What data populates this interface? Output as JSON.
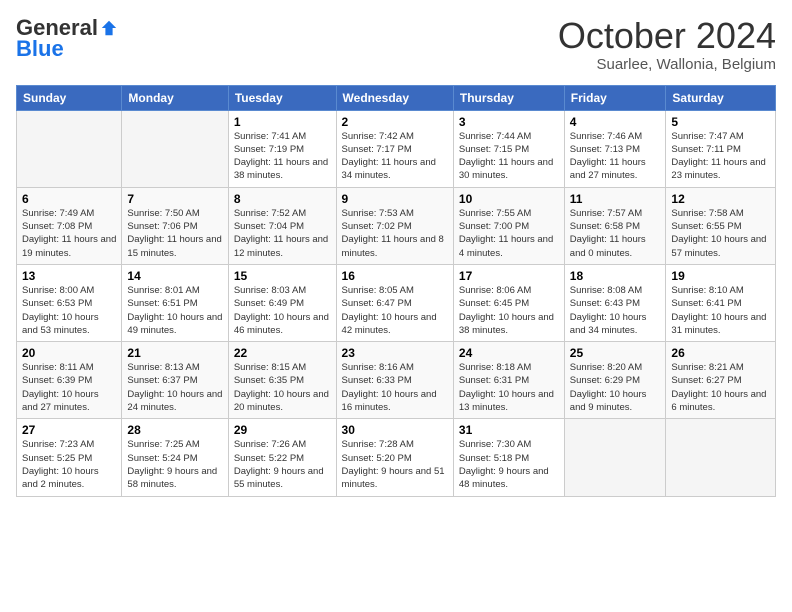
{
  "header": {
    "logo_general": "General",
    "logo_blue": "Blue",
    "month_title": "October 2024",
    "subtitle": "Suarlee, Wallonia, Belgium"
  },
  "days_of_week": [
    "Sunday",
    "Monday",
    "Tuesday",
    "Wednesday",
    "Thursday",
    "Friday",
    "Saturday"
  ],
  "weeks": [
    [
      {
        "day": "",
        "sunrise": "",
        "sunset": "",
        "daylight": "",
        "empty": true
      },
      {
        "day": "",
        "sunrise": "",
        "sunset": "",
        "daylight": "",
        "empty": true
      },
      {
        "day": "1",
        "sunrise": "Sunrise: 7:41 AM",
        "sunset": "Sunset: 7:19 PM",
        "daylight": "Daylight: 11 hours and 38 minutes.",
        "empty": false
      },
      {
        "day": "2",
        "sunrise": "Sunrise: 7:42 AM",
        "sunset": "Sunset: 7:17 PM",
        "daylight": "Daylight: 11 hours and 34 minutes.",
        "empty": false
      },
      {
        "day": "3",
        "sunrise": "Sunrise: 7:44 AM",
        "sunset": "Sunset: 7:15 PM",
        "daylight": "Daylight: 11 hours and 30 minutes.",
        "empty": false
      },
      {
        "day": "4",
        "sunrise": "Sunrise: 7:46 AM",
        "sunset": "Sunset: 7:13 PM",
        "daylight": "Daylight: 11 hours and 27 minutes.",
        "empty": false
      },
      {
        "day": "5",
        "sunrise": "Sunrise: 7:47 AM",
        "sunset": "Sunset: 7:11 PM",
        "daylight": "Daylight: 11 hours and 23 minutes.",
        "empty": false
      }
    ],
    [
      {
        "day": "6",
        "sunrise": "Sunrise: 7:49 AM",
        "sunset": "Sunset: 7:08 PM",
        "daylight": "Daylight: 11 hours and 19 minutes.",
        "empty": false
      },
      {
        "day": "7",
        "sunrise": "Sunrise: 7:50 AM",
        "sunset": "Sunset: 7:06 PM",
        "daylight": "Daylight: 11 hours and 15 minutes.",
        "empty": false
      },
      {
        "day": "8",
        "sunrise": "Sunrise: 7:52 AM",
        "sunset": "Sunset: 7:04 PM",
        "daylight": "Daylight: 11 hours and 12 minutes.",
        "empty": false
      },
      {
        "day": "9",
        "sunrise": "Sunrise: 7:53 AM",
        "sunset": "Sunset: 7:02 PM",
        "daylight": "Daylight: 11 hours and 8 minutes.",
        "empty": false
      },
      {
        "day": "10",
        "sunrise": "Sunrise: 7:55 AM",
        "sunset": "Sunset: 7:00 PM",
        "daylight": "Daylight: 11 hours and 4 minutes.",
        "empty": false
      },
      {
        "day": "11",
        "sunrise": "Sunrise: 7:57 AM",
        "sunset": "Sunset: 6:58 PM",
        "daylight": "Daylight: 11 hours and 0 minutes.",
        "empty": false
      },
      {
        "day": "12",
        "sunrise": "Sunrise: 7:58 AM",
        "sunset": "Sunset: 6:55 PM",
        "daylight": "Daylight: 10 hours and 57 minutes.",
        "empty": false
      }
    ],
    [
      {
        "day": "13",
        "sunrise": "Sunrise: 8:00 AM",
        "sunset": "Sunset: 6:53 PM",
        "daylight": "Daylight: 10 hours and 53 minutes.",
        "empty": false
      },
      {
        "day": "14",
        "sunrise": "Sunrise: 8:01 AM",
        "sunset": "Sunset: 6:51 PM",
        "daylight": "Daylight: 10 hours and 49 minutes.",
        "empty": false
      },
      {
        "day": "15",
        "sunrise": "Sunrise: 8:03 AM",
        "sunset": "Sunset: 6:49 PM",
        "daylight": "Daylight: 10 hours and 46 minutes.",
        "empty": false
      },
      {
        "day": "16",
        "sunrise": "Sunrise: 8:05 AM",
        "sunset": "Sunset: 6:47 PM",
        "daylight": "Daylight: 10 hours and 42 minutes.",
        "empty": false
      },
      {
        "day": "17",
        "sunrise": "Sunrise: 8:06 AM",
        "sunset": "Sunset: 6:45 PM",
        "daylight": "Daylight: 10 hours and 38 minutes.",
        "empty": false
      },
      {
        "day": "18",
        "sunrise": "Sunrise: 8:08 AM",
        "sunset": "Sunset: 6:43 PM",
        "daylight": "Daylight: 10 hours and 34 minutes.",
        "empty": false
      },
      {
        "day": "19",
        "sunrise": "Sunrise: 8:10 AM",
        "sunset": "Sunset: 6:41 PM",
        "daylight": "Daylight: 10 hours and 31 minutes.",
        "empty": false
      }
    ],
    [
      {
        "day": "20",
        "sunrise": "Sunrise: 8:11 AM",
        "sunset": "Sunset: 6:39 PM",
        "daylight": "Daylight: 10 hours and 27 minutes.",
        "empty": false
      },
      {
        "day": "21",
        "sunrise": "Sunrise: 8:13 AM",
        "sunset": "Sunset: 6:37 PM",
        "daylight": "Daylight: 10 hours and 24 minutes.",
        "empty": false
      },
      {
        "day": "22",
        "sunrise": "Sunrise: 8:15 AM",
        "sunset": "Sunset: 6:35 PM",
        "daylight": "Daylight: 10 hours and 20 minutes.",
        "empty": false
      },
      {
        "day": "23",
        "sunrise": "Sunrise: 8:16 AM",
        "sunset": "Sunset: 6:33 PM",
        "daylight": "Daylight: 10 hours and 16 minutes.",
        "empty": false
      },
      {
        "day": "24",
        "sunrise": "Sunrise: 8:18 AM",
        "sunset": "Sunset: 6:31 PM",
        "daylight": "Daylight: 10 hours and 13 minutes.",
        "empty": false
      },
      {
        "day": "25",
        "sunrise": "Sunrise: 8:20 AM",
        "sunset": "Sunset: 6:29 PM",
        "daylight": "Daylight: 10 hours and 9 minutes.",
        "empty": false
      },
      {
        "day": "26",
        "sunrise": "Sunrise: 8:21 AM",
        "sunset": "Sunset: 6:27 PM",
        "daylight": "Daylight: 10 hours and 6 minutes.",
        "empty": false
      }
    ],
    [
      {
        "day": "27",
        "sunrise": "Sunrise: 7:23 AM",
        "sunset": "Sunset: 5:25 PM",
        "daylight": "Daylight: 10 hours and 2 minutes.",
        "empty": false
      },
      {
        "day": "28",
        "sunrise": "Sunrise: 7:25 AM",
        "sunset": "Sunset: 5:24 PM",
        "daylight": "Daylight: 9 hours and 58 minutes.",
        "empty": false
      },
      {
        "day": "29",
        "sunrise": "Sunrise: 7:26 AM",
        "sunset": "Sunset: 5:22 PM",
        "daylight": "Daylight: 9 hours and 55 minutes.",
        "empty": false
      },
      {
        "day": "30",
        "sunrise": "Sunrise: 7:28 AM",
        "sunset": "Sunset: 5:20 PM",
        "daylight": "Daylight: 9 hours and 51 minutes.",
        "empty": false
      },
      {
        "day": "31",
        "sunrise": "Sunrise: 7:30 AM",
        "sunset": "Sunset: 5:18 PM",
        "daylight": "Daylight: 9 hours and 48 minutes.",
        "empty": false
      },
      {
        "day": "",
        "sunrise": "",
        "sunset": "",
        "daylight": "",
        "empty": true
      },
      {
        "day": "",
        "sunrise": "",
        "sunset": "",
        "daylight": "",
        "empty": true
      }
    ]
  ]
}
